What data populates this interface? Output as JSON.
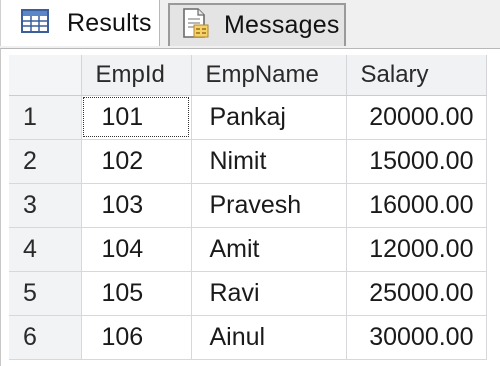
{
  "tabs": {
    "results": {
      "label": "Results",
      "icon": "grid-icon"
    },
    "messages": {
      "label": "Messages",
      "icon": "messages-document-icon"
    }
  },
  "grid": {
    "columns": [
      "EmpId",
      "EmpName",
      "Salary"
    ],
    "rows": [
      {
        "row": "1",
        "empid": "101",
        "empname": "Pankaj",
        "salary": "20000.00"
      },
      {
        "row": "2",
        "empid": "102",
        "empname": "Nimit",
        "salary": "15000.00"
      },
      {
        "row": "3",
        "empid": "103",
        "empname": "Pravesh",
        "salary": "16000.00"
      },
      {
        "row": "4",
        "empid": "104",
        "empname": "Amit",
        "salary": "12000.00"
      },
      {
        "row": "5",
        "empid": "105",
        "empname": "Ravi",
        "salary": "25000.00"
      },
      {
        "row": "6",
        "empid": "106",
        "empname": "Ainul",
        "salary": "30000.00"
      }
    ],
    "selected_cell": "1:EmpId"
  },
  "colors": {
    "grid_line": "#d6d8dc",
    "header_bg": "#f1f2f4",
    "tab_bg": "#f0f0f0"
  }
}
